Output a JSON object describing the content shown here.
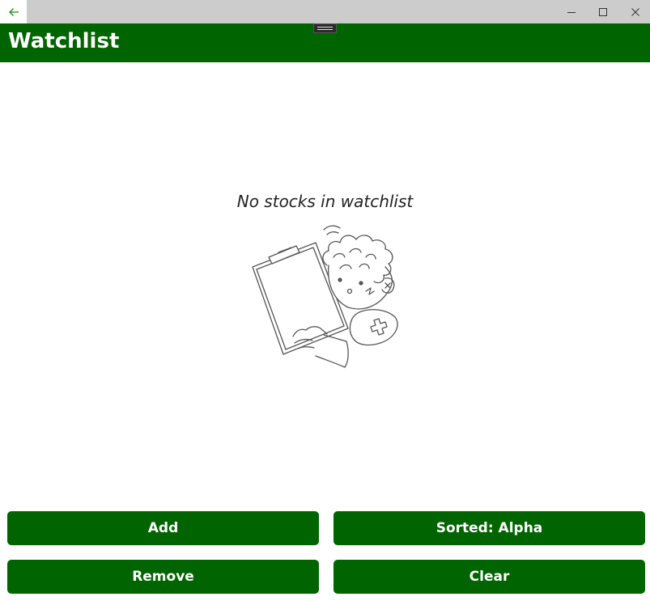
{
  "window": {
    "back_icon": "arrow-left-icon",
    "minimize_icon": "minimize-icon",
    "maximize_icon": "maximize-icon",
    "close_icon": "close-icon"
  },
  "header": {
    "title": "Watchlist",
    "accent_color": "#006400"
  },
  "main": {
    "empty_message": "No stocks in watchlist",
    "illustration_icon": "confused-person-with-clipboard-illustration"
  },
  "buttons": {
    "add_label": "Add",
    "sort_label": "Sorted: Alpha",
    "remove_label": "Remove",
    "clear_label": "Clear"
  }
}
